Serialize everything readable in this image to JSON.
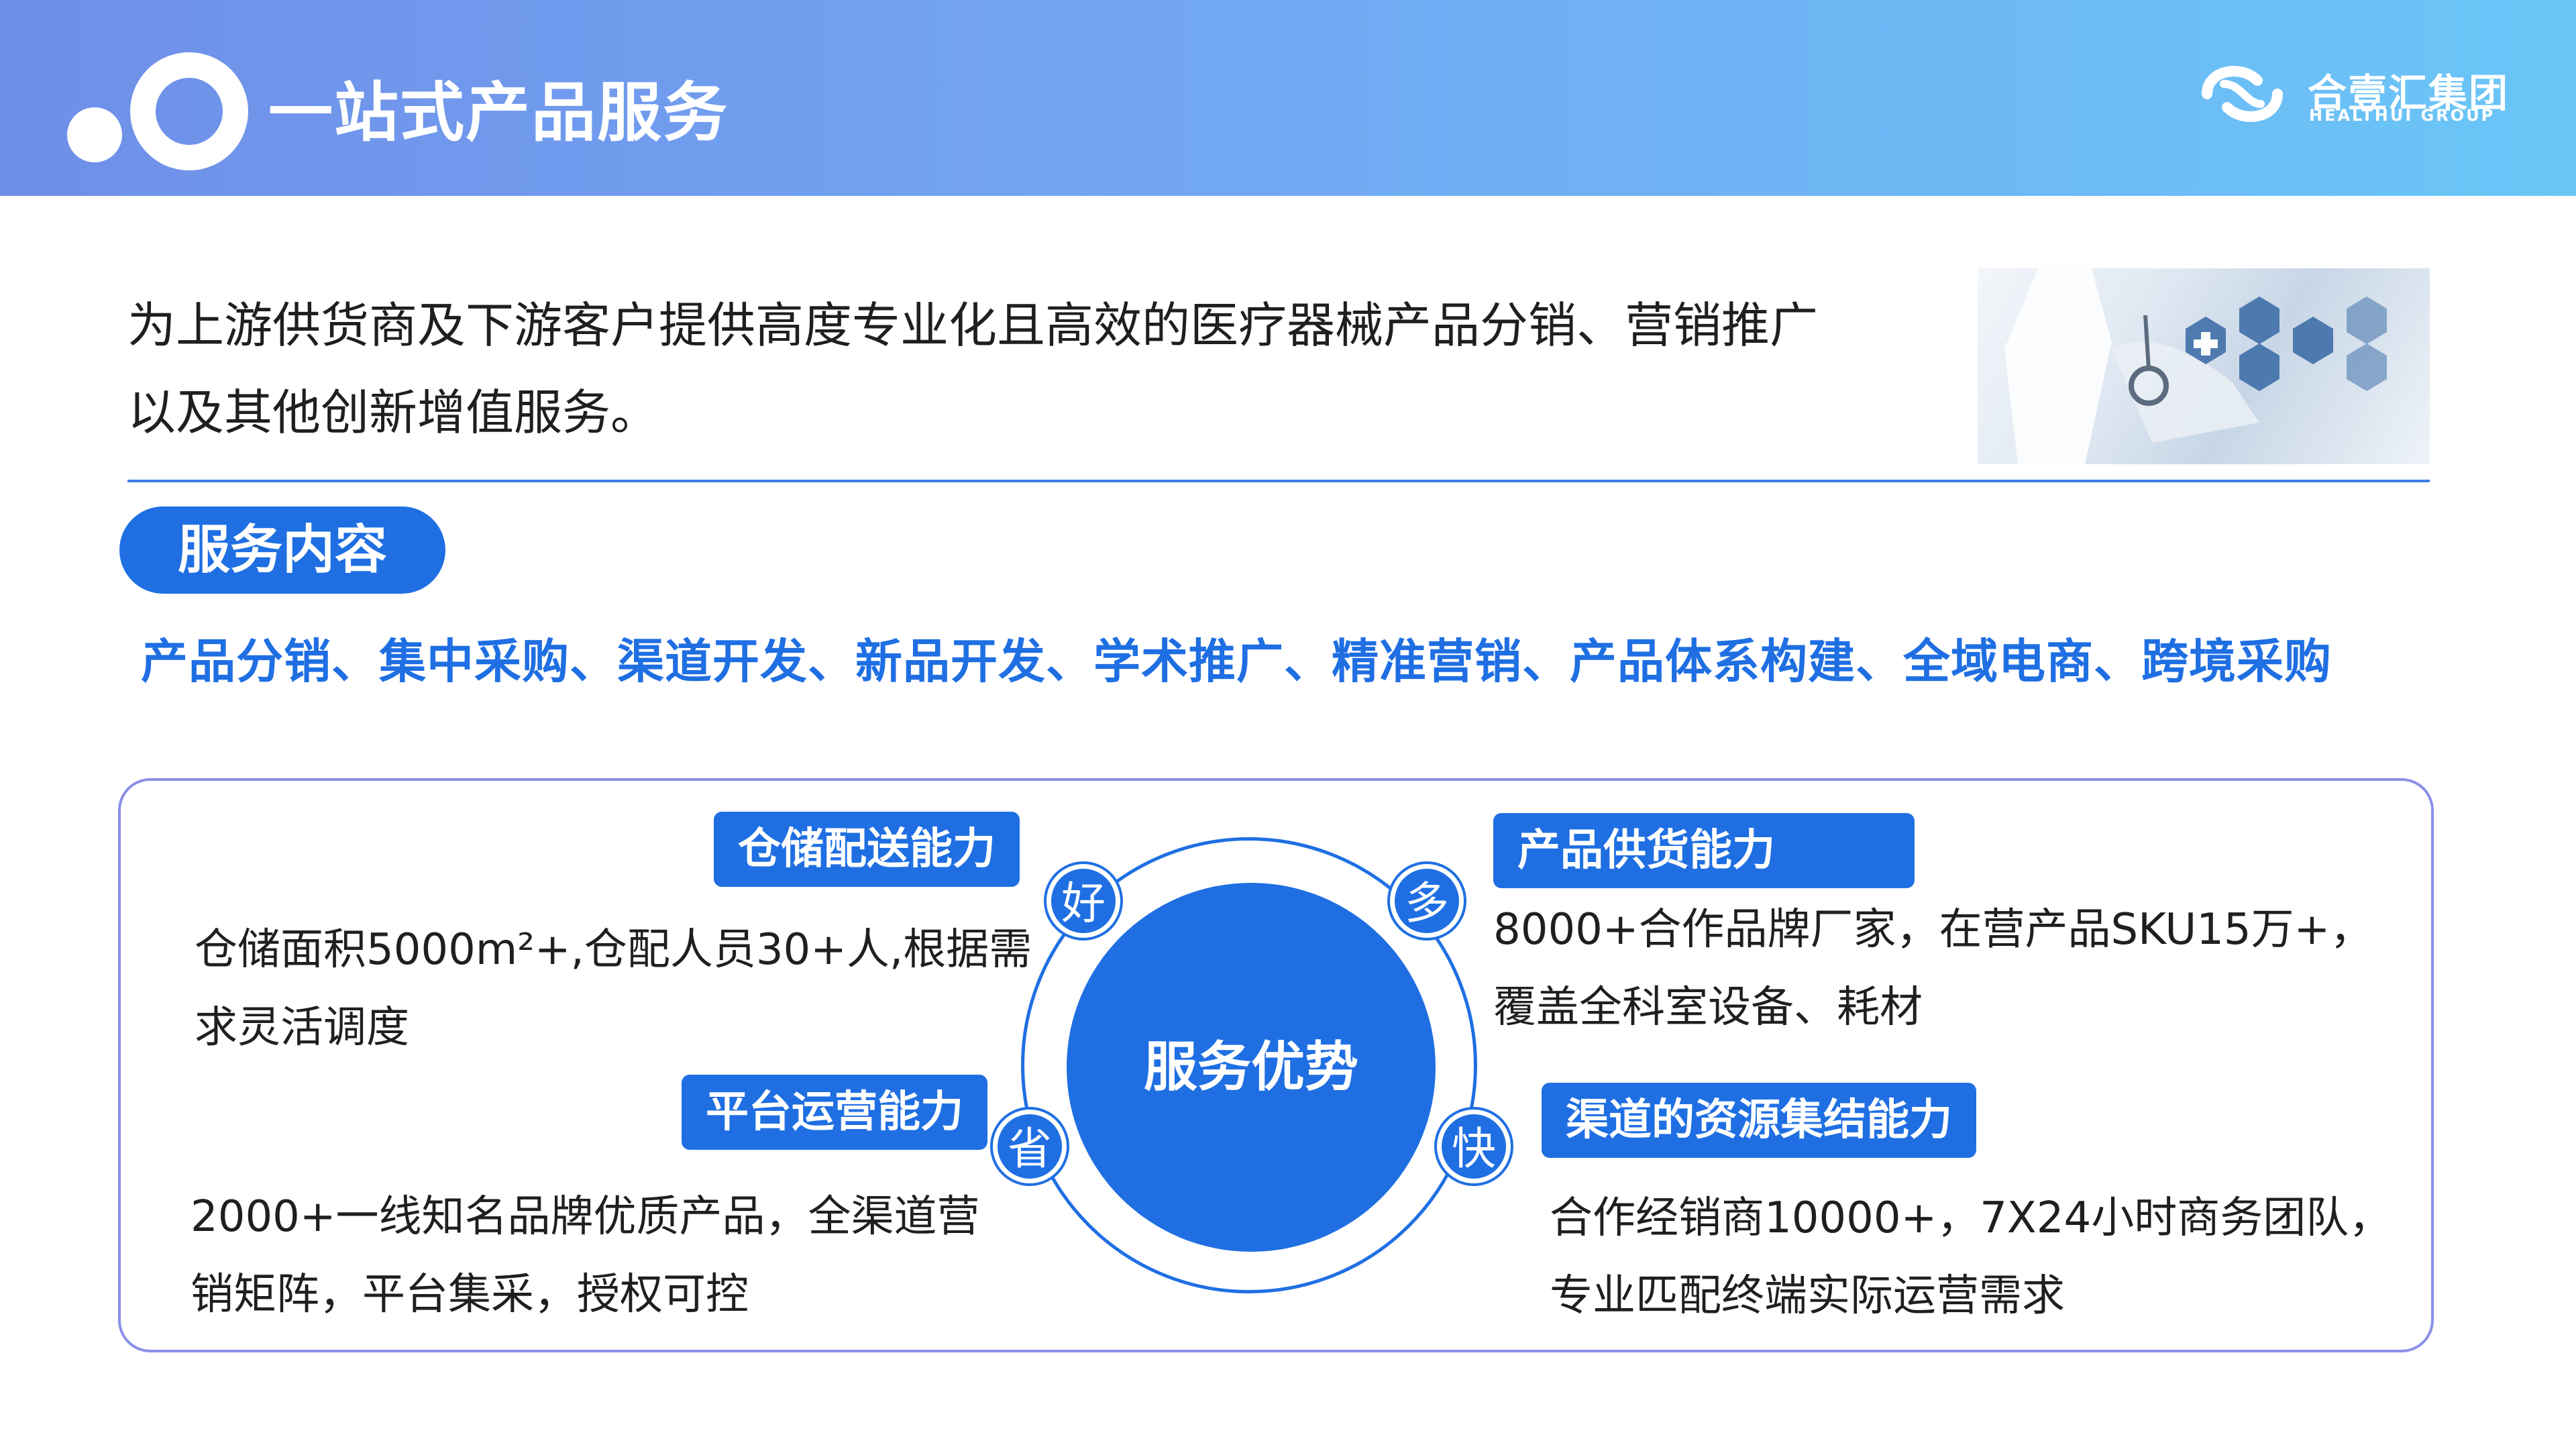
{
  "header": {
    "title": "一站式产品服务",
    "logo_cn": "合壹汇集团",
    "logo_en": "HEALTHUI GROUP"
  },
  "intro": {
    "text": "为上游供货商及下游客户提供高度专业化且高效的医疗器械产品分销、营销推广以及其他创新增值服务。"
  },
  "services": {
    "heading": "服务内容",
    "list_text": "产品分销、集中采购、渠道开发、新品开发、学术推广、精准营销、产品体系构建、全域电商、跨境采购"
  },
  "advantages": {
    "center": "服务优势",
    "badges": {
      "good": "好",
      "many": "多",
      "save": "省",
      "fast": "快"
    },
    "warehouse": {
      "label": "仓储配送能力",
      "line1": "仓储面积5000m²+,仓配人员30+人,根据需",
      "line2": "求灵活调度"
    },
    "supply": {
      "label": "产品供货能力",
      "line1": "8000+合作品牌厂家，在营产品SKU15万+，",
      "line2": "覆盖全科室设备、耗材"
    },
    "platform": {
      "label": "平台运营能力",
      "line1": "2000+一线知名品牌优质产品，全渠道营",
      "line2": "销矩阵，平台集采，授权可控"
    },
    "channel": {
      "label": "渠道的资源集结能力",
      "line1": "合作经销商10000+，7X24小时商务团队，",
      "line2": "专业匹配终端实际运营需求"
    }
  },
  "colors": {
    "accent": "#1f6fe3",
    "header_start": "#6f8fe8",
    "header_end": "#6ac6f7",
    "panel_border": "#8a8fe6"
  }
}
